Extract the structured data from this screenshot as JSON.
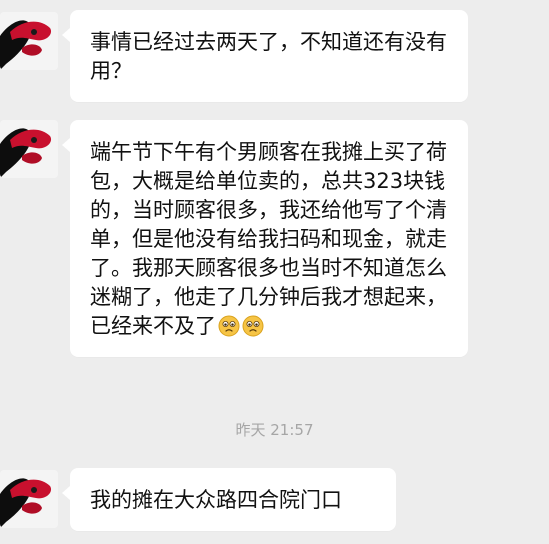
{
  "chat": {
    "messages": [
      {
        "id": "m1",
        "sender": "other",
        "text": "事情已经过去两天了，不知道还有没有用？"
      },
      {
        "id": "m2",
        "sender": "other",
        "text": "端午节下午有个男顾客在我摊上买了荷包，大概是给单位卖的，总共323块钱的，当时顾客很多，我还给他写了个清单，但是他没有给我扫码和现金，就走了。我那天顾客很多也当时不知道怎么迷糊了，他走了几分钟后我才想起来，已经来不及了",
        "emojis": [
          "sad-face-emoji",
          "sad-face-emoji"
        ]
      },
      {
        "id": "m3",
        "sender": "other",
        "text": "我的摊在大众路四合院门口"
      }
    ],
    "timestamp": "昨天 21:57"
  },
  "colors": {
    "background": "#ededed",
    "bubble": "#ffffff",
    "text": "#111111",
    "timestamp": "#a6a6a6",
    "avatar_accent": "#c8102e"
  }
}
